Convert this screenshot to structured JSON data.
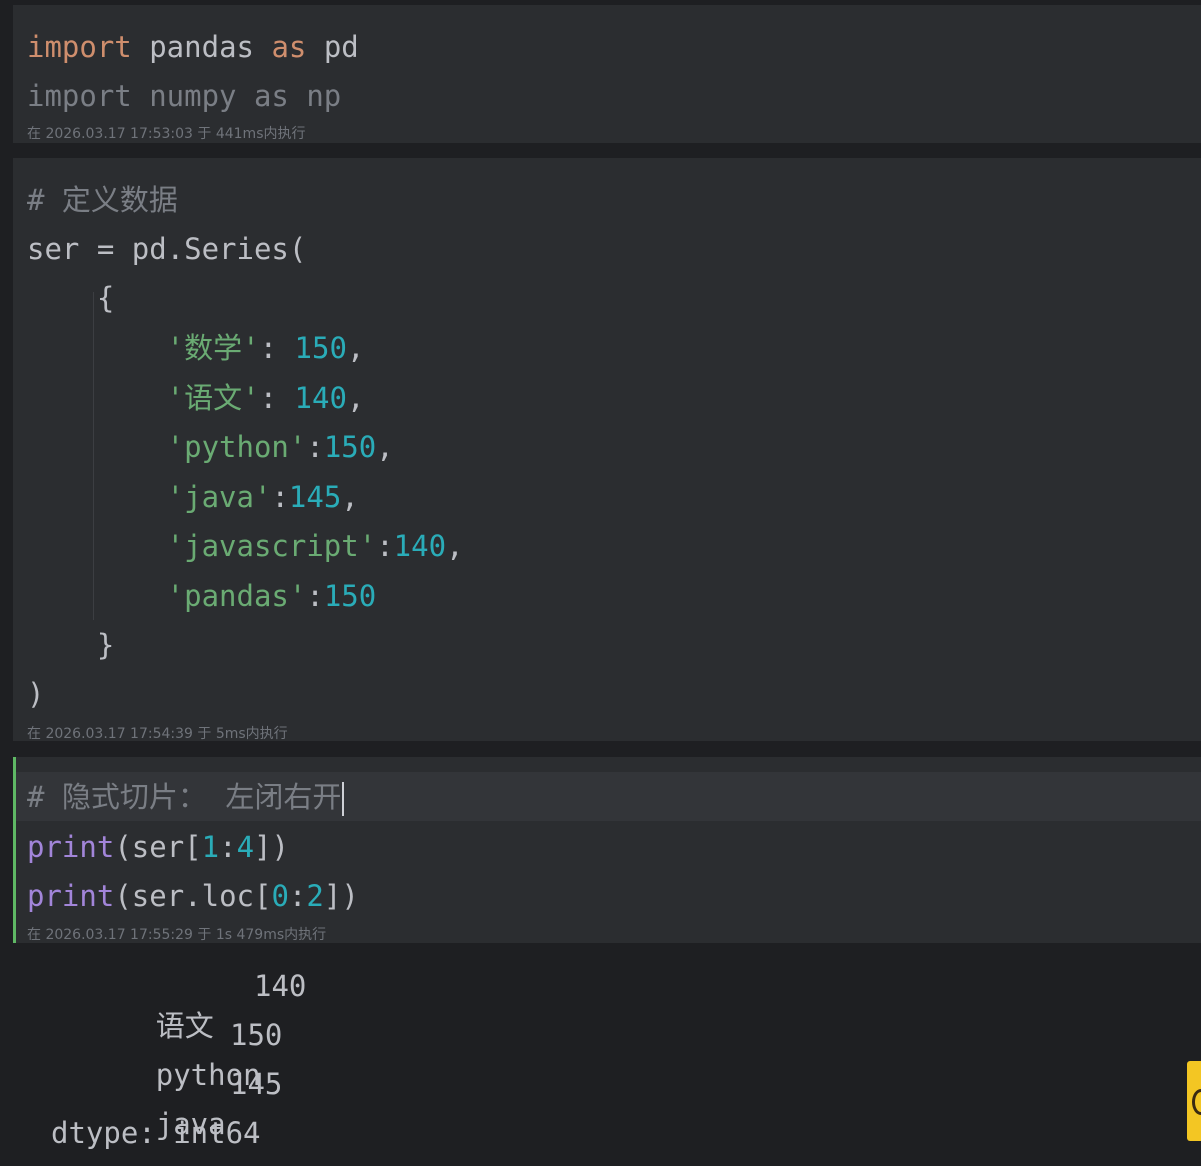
{
  "cells": [
    {
      "lines": [
        [
          {
            "t": "import",
            "c": "kw"
          },
          {
            "t": " pandas ",
            "c": "mod"
          },
          {
            "t": "as",
            "c": "kw"
          },
          {
            "t": " pd",
            "c": "mod"
          }
        ],
        [
          {
            "t": "import numpy as np",
            "c": "dim"
          }
        ]
      ],
      "status": "在 2026.03.17 17:53:03 于 441ms内执行"
    },
    {
      "lines": [
        [
          {
            "t": "# ",
            "c": "cmt"
          },
          {
            "t": "定义数据",
            "c": "cmt cjk"
          }
        ],
        [
          {
            "t": "ser = pd.Series(",
            "c": "punc"
          }
        ],
        [
          {
            "t": "    {",
            "c": "punc"
          }
        ],
        [
          {
            "t": "        '",
            "c": "str"
          },
          {
            "t": "数学",
            "c": "str cjk"
          },
          {
            "t": "'",
            "c": "str"
          },
          {
            "t": ": ",
            "c": "punc"
          },
          {
            "t": "150",
            "c": "num"
          },
          {
            "t": ",",
            "c": "punc"
          }
        ],
        [
          {
            "t": "        '",
            "c": "str"
          },
          {
            "t": "语文",
            "c": "str cjk"
          },
          {
            "t": "'",
            "c": "str"
          },
          {
            "t": ": ",
            "c": "punc"
          },
          {
            "t": "140",
            "c": "num"
          },
          {
            "t": ",",
            "c": "punc"
          }
        ],
        [
          {
            "t": "        'python'",
            "c": "str"
          },
          {
            "t": ":",
            "c": "punc"
          },
          {
            "t": "150",
            "c": "num"
          },
          {
            "t": ",",
            "c": "punc"
          }
        ],
        [
          {
            "t": "        'java'",
            "c": "str"
          },
          {
            "t": ":",
            "c": "punc"
          },
          {
            "t": "145",
            "c": "num"
          },
          {
            "t": ",",
            "c": "punc"
          }
        ],
        [
          {
            "t": "        'javascript'",
            "c": "str"
          },
          {
            "t": ":",
            "c": "punc"
          },
          {
            "t": "140",
            "c": "num"
          },
          {
            "t": ",",
            "c": "punc"
          }
        ],
        [
          {
            "t": "        'pandas'",
            "c": "str"
          },
          {
            "t": ":",
            "c": "punc"
          },
          {
            "t": "150",
            "c": "num"
          }
        ],
        [
          {
            "t": "    }",
            "c": "punc"
          }
        ],
        [
          {
            "t": ")",
            "c": "punc"
          }
        ]
      ],
      "status": "在 2026.03.17 17:54:39 于 5ms内执行"
    },
    {
      "lines": [
        [
          {
            "t": "# ",
            "c": "cmt"
          },
          {
            "t": "隐式切片：  左闭右开",
            "c": "cmt cjk"
          }
        ],
        [
          {
            "t": "print",
            "c": "fn"
          },
          {
            "t": "(ser[",
            "c": "punc"
          },
          {
            "t": "1",
            "c": "num"
          },
          {
            "t": ":",
            "c": "punc"
          },
          {
            "t": "4",
            "c": "num"
          },
          {
            "t": "])",
            "c": "punc"
          }
        ],
        [
          {
            "t": "print",
            "c": "fn"
          },
          {
            "t": "(ser.loc[",
            "c": "punc"
          },
          {
            "t": "0",
            "c": "num"
          },
          {
            "t": ":",
            "c": "punc"
          },
          {
            "t": "2",
            "c": "num"
          },
          {
            "t": "])",
            "c": "punc"
          }
        ]
      ],
      "status": "在 2026.03.17 17:55:29 于 1s 479ms内执行"
    }
  ],
  "output": {
    "rows": [
      {
        "label": "语文",
        "value": "140"
      },
      {
        "label": "python",
        "value": "150"
      },
      {
        "label": "java",
        "value": "145"
      }
    ],
    "dtype_line": "dtype: int64"
  },
  "colors": {
    "editor_bg": "#1e1f22",
    "cell_bg": "#2b2d30",
    "keyword": "#cf8e6d",
    "string": "#6aab73",
    "number": "#2aacb8",
    "function": "#a285d9",
    "comment": "#7a7e85",
    "text": "#bcbec4",
    "active_cell_bar": "#5fb865",
    "side_widget": "#f3c623"
  }
}
